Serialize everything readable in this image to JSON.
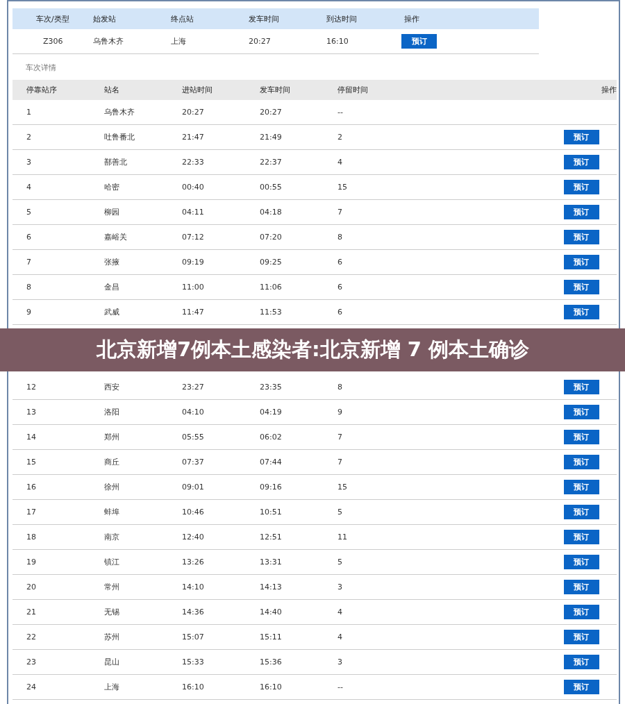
{
  "train": {
    "columns": [
      "车次/类型",
      "始发站",
      "终点站",
      "发车时间",
      "到达时间",
      "操作"
    ],
    "row": {
      "train_no": "Z306",
      "origin": "乌鲁木齐",
      "destination": "上海",
      "departure": "20:27",
      "arrival": "16:10",
      "button": "预订"
    }
  },
  "details_title": "车次详情",
  "stops": {
    "columns": [
      "停靠站序",
      "站名",
      "进站时间",
      "发车时间",
      "停留时间",
      "操作"
    ],
    "rows": [
      {
        "seq": "1",
        "station": "乌鲁木齐",
        "arrive": "20:27",
        "depart": "20:27",
        "stay": "--"
      },
      {
        "seq": "2",
        "station": "吐鲁番北",
        "arrive": "21:47",
        "depart": "21:49",
        "stay": "2",
        "button": "预订"
      },
      {
        "seq": "3",
        "station": "鄯善北",
        "arrive": "22:33",
        "depart": "22:37",
        "stay": "4",
        "button": "预订"
      },
      {
        "seq": "4",
        "station": "哈密",
        "arrive": "00:40",
        "depart": "00:55",
        "stay": "15",
        "button": "预订"
      },
      {
        "seq": "5",
        "station": "柳园",
        "arrive": "04:11",
        "depart": "04:18",
        "stay": "7",
        "button": "预订"
      },
      {
        "seq": "6",
        "station": "嘉峪关",
        "arrive": "07:12",
        "depart": "07:20",
        "stay": "8",
        "button": "预订"
      },
      {
        "seq": "7",
        "station": "张掖",
        "arrive": "09:19",
        "depart": "09:25",
        "stay": "6",
        "button": "预订"
      },
      {
        "seq": "8",
        "station": "金昌",
        "arrive": "11:00",
        "depart": "11:06",
        "stay": "6",
        "button": "预订"
      },
      {
        "seq": "9",
        "station": "武威",
        "arrive": "11:47",
        "depart": "11:53",
        "stay": "6",
        "button": "预订"
      },
      {
        "kind": "banner",
        "text": "北京新增7例本土感染者:北京新增 7 例本土确诊"
      },
      {
        "seq": "12",
        "station": "西安",
        "arrive": "23:27",
        "depart": "23:35",
        "stay": "8",
        "button": "预订"
      },
      {
        "seq": "13",
        "station": "洛阳",
        "arrive": "04:10",
        "depart": "04:19",
        "stay": "9",
        "button": "预订"
      },
      {
        "seq": "14",
        "station": "郑州",
        "arrive": "05:55",
        "depart": "06:02",
        "stay": "7",
        "button": "预订"
      },
      {
        "seq": "15",
        "station": "商丘",
        "arrive": "07:37",
        "depart": "07:44",
        "stay": "7",
        "button": "预订"
      },
      {
        "seq": "16",
        "station": "徐州",
        "arrive": "09:01",
        "depart": "09:16",
        "stay": "15",
        "button": "预订"
      },
      {
        "seq": "17",
        "station": "蚌埠",
        "arrive": "10:46",
        "depart": "10:51",
        "stay": "5",
        "button": "预订"
      },
      {
        "seq": "18",
        "station": "南京",
        "arrive": "12:40",
        "depart": "12:51",
        "stay": "11",
        "button": "预订"
      },
      {
        "seq": "19",
        "station": "镇江",
        "arrive": "13:26",
        "depart": "13:31",
        "stay": "5",
        "button": "预订"
      },
      {
        "seq": "20",
        "station": "常州",
        "arrive": "14:10",
        "depart": "14:13",
        "stay": "3",
        "button": "预订"
      },
      {
        "seq": "21",
        "station": "无锡",
        "arrive": "14:36",
        "depart": "14:40",
        "stay": "4",
        "button": "预订"
      },
      {
        "seq": "22",
        "station": "苏州",
        "arrive": "15:07",
        "depart": "15:11",
        "stay": "4",
        "button": "预订"
      },
      {
        "seq": "23",
        "station": "昆山",
        "arrive": "15:33",
        "depart": "15:36",
        "stay": "3",
        "button": "预订"
      },
      {
        "seq": "24",
        "station": "上海",
        "arrive": "16:10",
        "depart": "16:10",
        "stay": "--",
        "button": "预订"
      }
    ]
  }
}
